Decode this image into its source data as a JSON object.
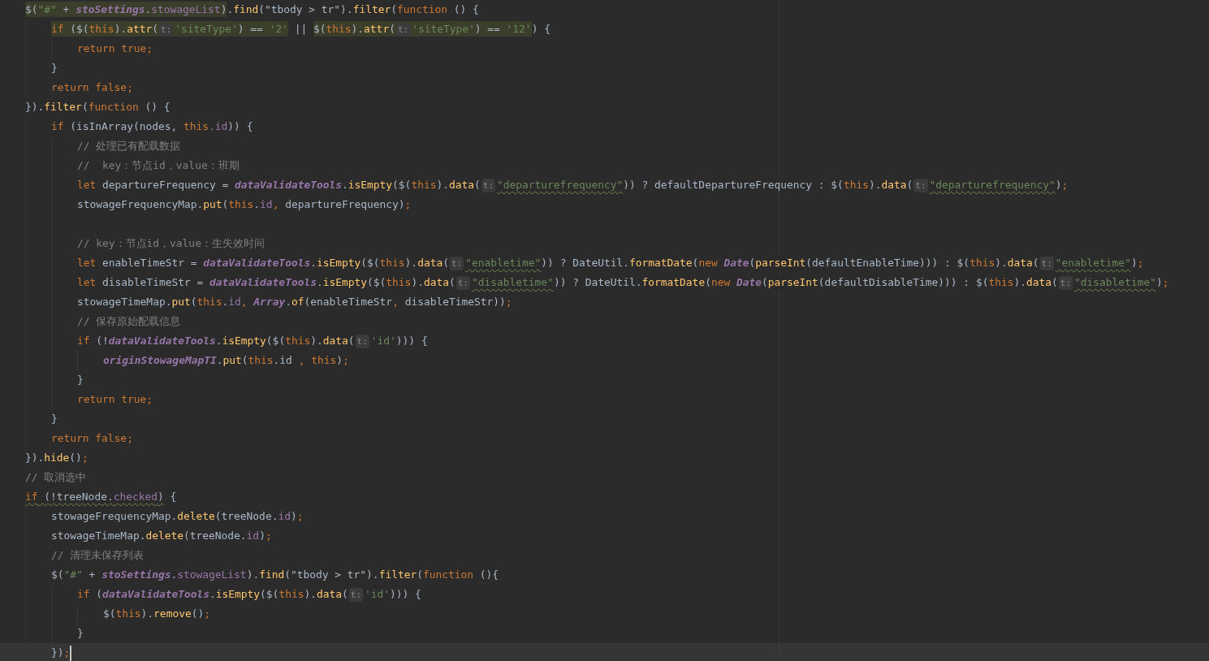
{
  "editor": {
    "lines": [
      {
        "current": false,
        "tokens": [
          {
            "kind": "highlight",
            "tokens": [
              {
                "kind": "plain",
                "text": "$("
              },
              {
                "kind": "string",
                "text": "\"#\""
              },
              {
                "kind": "plain",
                "text": " + "
              },
              {
                "kind": "static",
                "text": "stoSettings"
              },
              {
                "kind": "plain",
                "text": "."
              },
              {
                "kind": "field",
                "text": "stowageList"
              },
              {
                "kind": "plain",
                "text": ")"
              }
            ]
          },
          {
            "kind": "plain",
            "text": "."
          },
          {
            "kind": "method",
            "text": "find"
          },
          {
            "kind": "plain",
            "text": "(\"tbody > tr\")."
          },
          {
            "kind": "method",
            "text": "filter"
          },
          {
            "kind": "plain",
            "text": "("
          },
          {
            "kind": "keyword",
            "text": "function"
          },
          {
            "kind": "plain",
            "text": " () {"
          }
        ],
        "children": [
          {
            "current": false,
            "tokens": [
              {
                "kind": "highlight",
                "tokens": [
                  {
                    "kind": "keyword",
                    "text": "if"
                  },
                  {
                    "kind": "plain",
                    "text": " ($("
                  },
                  {
                    "kind": "keyword",
                    "text": "this"
                  },
                  {
                    "kind": "plain",
                    "text": ")."
                  },
                  {
                    "kind": "method",
                    "text": "attr"
                  },
                  {
                    "kind": "plain",
                    "text": "("
                  },
                  {
                    "kind": "hint",
                    "text": "t:"
                  },
                  {
                    "kind": "string",
                    "text": "'siteType'"
                  },
                  {
                    "kind": "plain",
                    "text": ") == "
                  },
                  {
                    "kind": "string",
                    "text": "'2'"
                  }
                ]
              },
              {
                "kind": "plain",
                "text": " || "
              },
              {
                "kind": "highlight",
                "tokens": [
                  {
                    "kind": "plain",
                    "text": "$("
                  },
                  {
                    "kind": "keyword",
                    "text": "this"
                  },
                  {
                    "kind": "plain",
                    "text": ")."
                  },
                  {
                    "kind": "method",
                    "text": "attr"
                  },
                  {
                    "kind": "plain",
                    "text": "("
                  },
                  {
                    "kind": "hint",
                    "text": "t:"
                  },
                  {
                    "kind": "string",
                    "text": "'siteType'"
                  },
                  {
                    "kind": "plain",
                    "text": ") == "
                  },
                  {
                    "kind": "string",
                    "text": "'12'"
                  }
                ]
              },
              {
                "kind": "plain",
                "text": ") {"
              }
            ],
            "children": [
              {
                "current": false,
                "tokens": [
                  {
                    "kind": "keyword",
                    "text": "return true;"
                  }
                ]
              }
            ]
          },
          {
            "current": false,
            "tokens": [
              {
                "kind": "plain",
                "text": "}"
              }
            ]
          },
          {
            "current": false,
            "tokens": [
              {
                "kind": "keyword",
                "text": "return false;"
              }
            ]
          }
        ]
      },
      {
        "current": false,
        "tokens": [
          {
            "kind": "plain",
            "text": "})."
          },
          {
            "kind": "method",
            "text": "filter"
          },
          {
            "kind": "plain",
            "text": "("
          },
          {
            "kind": "keyword",
            "text": "function"
          },
          {
            "kind": "plain",
            "text": " () {"
          }
        ],
        "children": [
          {
            "current": false,
            "tokens": [
              {
                "kind": "keyword",
                "text": "if"
              },
              {
                "kind": "plain",
                "text": " (isInArray(nodes, "
              },
              {
                "kind": "keyword",
                "text": "this"
              },
              {
                "kind": "field",
                "text": ".id"
              },
              {
                "kind": "plain",
                "text": ")) {"
              }
            ],
            "children": [
              {
                "current": false,
                "tokens": [
                  {
                    "kind": "comment",
                    "text": "// 处理已有配载数据"
                  }
                ]
              },
              {
                "current": false,
                "tokens": [
                  {
                    "kind": "comment",
                    "text": "//  key：节点id，value：班期"
                  }
                ]
              },
              {
                "current": false,
                "tokens": [
                  {
                    "kind": "keyword",
                    "text": "let"
                  },
                  {
                    "kind": "plain",
                    "text": " departureFrequency = "
                  },
                  {
                    "kind": "static",
                    "text": "dataValidateTools"
                  },
                  {
                    "kind": "plain",
                    "text": "."
                  },
                  {
                    "kind": "method",
                    "text": "isEmpty"
                  },
                  {
                    "kind": "plain",
                    "text": "($("
                  },
                  {
                    "kind": "keyword",
                    "text": "this"
                  },
                  {
                    "kind": "plain",
                    "text": ")."
                  },
                  {
                    "kind": "method",
                    "text": "data"
                  },
                  {
                    "kind": "plain",
                    "text": "("
                  },
                  {
                    "kind": "hint",
                    "text": "t:"
                  },
                  {
                    "kind": "warning",
                    "tokens": [
                      {
                        "kind": "string",
                        "text": "\"departurefrequency\""
                      }
                    ]
                  },
                  {
                    "kind": "plain",
                    "text": ")) ? defaultDepartureFrequency : $("
                  },
                  {
                    "kind": "keyword",
                    "text": "this"
                  },
                  {
                    "kind": "plain",
                    "text": ")."
                  },
                  {
                    "kind": "method",
                    "text": "data"
                  },
                  {
                    "kind": "plain",
                    "text": "("
                  },
                  {
                    "kind": "hint",
                    "text": "t:"
                  },
                  {
                    "kind": "warning",
                    "tokens": [
                      {
                        "kind": "string",
                        "text": "\"departurefrequency\""
                      }
                    ]
                  },
                  {
                    "kind": "plain",
                    "text": ")"
                  },
                  {
                    "kind": "keyword",
                    "text": ";"
                  }
                ]
              },
              {
                "current": false,
                "tokens": [
                  {
                    "kind": "plain",
                    "text": "stowageFrequencyMap."
                  },
                  {
                    "kind": "method",
                    "text": "put"
                  },
                  {
                    "kind": "plain",
                    "text": "("
                  },
                  {
                    "kind": "keyword",
                    "text": "this"
                  },
                  {
                    "kind": "plain",
                    "text": "."
                  },
                  {
                    "kind": "field",
                    "text": "id"
                  },
                  {
                    "kind": "keyword",
                    "text": ","
                  },
                  {
                    "kind": "plain",
                    "text": " departureFrequency)"
                  },
                  {
                    "kind": "keyword",
                    "text": ";"
                  }
                ]
              },
              {
                "current": false
              },
              {
                "current": false,
                "tokens": [
                  {
                    "kind": "comment",
                    "text": "// key：节点id，value：生失效时间"
                  }
                ]
              },
              {
                "current": false,
                "tokens": [
                  {
                    "kind": "keyword",
                    "text": "let"
                  },
                  {
                    "kind": "plain",
                    "text": " enableTimeStr = "
                  },
                  {
                    "kind": "static",
                    "text": "dataValidateTools"
                  },
                  {
                    "kind": "plain",
                    "text": "."
                  },
                  {
                    "kind": "method",
                    "text": "isEmpty"
                  },
                  {
                    "kind": "plain",
                    "text": "($("
                  },
                  {
                    "kind": "keyword",
                    "text": "this"
                  },
                  {
                    "kind": "plain",
                    "text": ")."
                  },
                  {
                    "kind": "method",
                    "text": "data"
                  },
                  {
                    "kind": "plain",
                    "text": "("
                  },
                  {
                    "kind": "hint",
                    "text": "t:"
                  },
                  {
                    "kind": "warning",
                    "tokens": [
                      {
                        "kind": "string",
                        "text": "\"enabletime\""
                      }
                    ]
                  },
                  {
                    "kind": "plain",
                    "text": ")) ? DateUtil."
                  },
                  {
                    "kind": "method",
                    "text": "formatDate"
                  },
                  {
                    "kind": "plain",
                    "text": "("
                  },
                  {
                    "kind": "keyword",
                    "text": "new "
                  },
                  {
                    "kind": "static",
                    "text": "Date"
                  },
                  {
                    "kind": "plain",
                    "text": "("
                  },
                  {
                    "kind": "method",
                    "text": "parseInt"
                  },
                  {
                    "kind": "plain",
                    "text": "(defaultEnableTime))) : $("
                  },
                  {
                    "kind": "keyword",
                    "text": "this"
                  },
                  {
                    "kind": "plain",
                    "text": ")."
                  },
                  {
                    "kind": "method",
                    "text": "data"
                  },
                  {
                    "kind": "plain",
                    "text": "("
                  },
                  {
                    "kind": "hint",
                    "text": "t:"
                  },
                  {
                    "kind": "warning",
                    "tokens": [
                      {
                        "kind": "string",
                        "text": "\"enabletime\""
                      }
                    ]
                  },
                  {
                    "kind": "plain",
                    "text": ")"
                  },
                  {
                    "kind": "keyword",
                    "text": ";"
                  }
                ]
              },
              {
                "current": false,
                "tokens": [
                  {
                    "kind": "keyword",
                    "text": "let"
                  },
                  {
                    "kind": "plain",
                    "text": " disableTimeStr = "
                  },
                  {
                    "kind": "static",
                    "text": "dataValidateTools"
                  },
                  {
                    "kind": "plain",
                    "text": "."
                  },
                  {
                    "kind": "method",
                    "text": "isEmpty"
                  },
                  {
                    "kind": "plain",
                    "text": "($("
                  },
                  {
                    "kind": "keyword",
                    "text": "this"
                  },
                  {
                    "kind": "plain",
                    "text": ")."
                  },
                  {
                    "kind": "method",
                    "text": "data"
                  },
                  {
                    "kind": "plain",
                    "text": "("
                  },
                  {
                    "kind": "hint",
                    "text": "t:"
                  },
                  {
                    "kind": "warning",
                    "tokens": [
                      {
                        "kind": "string",
                        "text": "\"disabletime\""
                      }
                    ]
                  },
                  {
                    "kind": "plain",
                    "text": ")) ? DateUtil."
                  },
                  {
                    "kind": "method",
                    "text": "formatDate"
                  },
                  {
                    "kind": "plain",
                    "text": "("
                  },
                  {
                    "kind": "keyword",
                    "text": "new "
                  },
                  {
                    "kind": "static",
                    "text": "Date"
                  },
                  {
                    "kind": "plain",
                    "text": "("
                  },
                  {
                    "kind": "method",
                    "text": "parseInt"
                  },
                  {
                    "kind": "plain",
                    "text": "(defaultDisableTime))) : $("
                  },
                  {
                    "kind": "keyword",
                    "text": "this"
                  },
                  {
                    "kind": "plain",
                    "text": ")."
                  },
                  {
                    "kind": "method",
                    "text": "data"
                  },
                  {
                    "kind": "plain",
                    "text": "("
                  },
                  {
                    "kind": "hint",
                    "text": "t:"
                  },
                  {
                    "kind": "warning",
                    "tokens": [
                      {
                        "kind": "string",
                        "text": "\"disabletime\""
                      }
                    ]
                  },
                  {
                    "kind": "plain",
                    "text": ")"
                  },
                  {
                    "kind": "keyword",
                    "text": ";"
                  }
                ]
              },
              {
                "current": false,
                "tokens": [
                  {
                    "kind": "plain",
                    "text": "stowageTimeMap."
                  },
                  {
                    "kind": "method",
                    "text": "put"
                  },
                  {
                    "kind": "plain",
                    "text": "("
                  },
                  {
                    "kind": "keyword",
                    "text": "this"
                  },
                  {
                    "kind": "plain",
                    "text": "."
                  },
                  {
                    "kind": "field",
                    "text": "id"
                  },
                  {
                    "kind": "keyword",
                    "text": ", "
                  },
                  {
                    "kind": "static",
                    "text": "Array"
                  },
                  {
                    "kind": "plain",
                    "text": "."
                  },
                  {
                    "kind": "method",
                    "text": "of"
                  },
                  {
                    "kind": "plain",
                    "text": "(enableTimeStr"
                  },
                  {
                    "kind": "keyword",
                    "text": ","
                  },
                  {
                    "kind": "plain",
                    "text": " disableTimeStr))"
                  },
                  {
                    "kind": "keyword",
                    "text": ";"
                  }
                ]
              },
              {
                "current": false,
                "tokens": [
                  {
                    "kind": "comment",
                    "text": "// 保存原始配载信息"
                  }
                ]
              },
              {
                "current": false,
                "tokens": [
                  {
                    "kind": "keyword",
                    "text": "if"
                  },
                  {
                    "kind": "plain",
                    "text": " (!"
                  },
                  {
                    "kind": "static",
                    "text": "dataValidateTools"
                  },
                  {
                    "kind": "plain",
                    "text": "."
                  },
                  {
                    "kind": "method",
                    "text": "isEmpty"
                  },
                  {
                    "kind": "plain",
                    "text": "($("
                  },
                  {
                    "kind": "keyword",
                    "text": "this"
                  },
                  {
                    "kind": "plain",
                    "text": ")."
                  },
                  {
                    "kind": "method",
                    "text": "data"
                  },
                  {
                    "kind": "plain",
                    "text": "("
                  },
                  {
                    "kind": "hint",
                    "text": "t:"
                  },
                  {
                    "kind": "string",
                    "text": "'id'"
                  },
                  {
                    "kind": "plain",
                    "text": "))) {"
                  }
                ],
                "children": [
                  {
                    "current": false,
                    "tokens": [
                      {
                        "kind": "static",
                        "text": "originStowageMapTI"
                      },
                      {
                        "kind": "plain",
                        "text": "."
                      },
                      {
                        "kind": "method",
                        "text": "put"
                      },
                      {
                        "kind": "plain",
                        "text": "("
                      },
                      {
                        "kind": "keyword",
                        "text": "this"
                      },
                      {
                        "kind": "plain",
                        "text": ".id "
                      },
                      {
                        "kind": "keyword",
                        "text": ", "
                      },
                      {
                        "kind": "keyword",
                        "text": "this"
                      },
                      {
                        "kind": "plain",
                        "text": ")"
                      },
                      {
                        "kind": "keyword",
                        "text": ";"
                      }
                    ]
                  }
                ]
              },
              {
                "current": false,
                "tokens": [
                  {
                    "kind": "plain",
                    "text": "}"
                  }
                ]
              },
              {
                "current": false,
                "tokens": [
                  {
                    "kind": "keyword",
                    "text": "return true;"
                  }
                ]
              }
            ]
          },
          {
            "current": false,
            "tokens": [
              {
                "kind": "plain",
                "text": "}"
              }
            ]
          },
          {
            "current": false,
            "tokens": [
              {
                "kind": "keyword",
                "text": "return false;"
              }
            ]
          }
        ]
      },
      {
        "current": false,
        "tokens": [
          {
            "kind": "plain",
            "text": "})."
          },
          {
            "kind": "method",
            "text": "hide"
          },
          {
            "kind": "plain",
            "text": "()"
          },
          {
            "kind": "keyword",
            "text": ";"
          }
        ]
      },
      {
        "current": false,
        "tokens": [
          {
            "kind": "comment",
            "text": "// 取消选中"
          }
        ]
      },
      {
        "current": false,
        "tokens": [
          {
            "kind": "warning",
            "tokens": [
              {
                "kind": "keyword",
                "text": "if"
              },
              {
                "kind": "plain",
                "text": " (!treeNode."
              },
              {
                "kind": "field",
                "text": "checked"
              },
              {
                "kind": "plain",
                "text": ")"
              }
            ]
          },
          {
            "kind": "plain",
            "text": " {"
          }
        ],
        "children": [
          {
            "current": false,
            "tokens": [
              {
                "kind": "plain",
                "text": "stowageFrequencyMap."
              },
              {
                "kind": "method",
                "text": "delete"
              },
              {
                "kind": "plain",
                "text": "(treeNode."
              },
              {
                "kind": "field",
                "text": "id"
              },
              {
                "kind": "plain",
                "text": ")"
              },
              {
                "kind": "keyword",
                "text": ";"
              }
            ]
          },
          {
            "current": false,
            "tokens": [
              {
                "kind": "plain",
                "text": "stowageTimeMap."
              },
              {
                "kind": "method",
                "text": "delete"
              },
              {
                "kind": "plain",
                "text": "(treeNode."
              },
              {
                "kind": "field",
                "text": "id"
              },
              {
                "kind": "plain",
                "text": ")"
              },
              {
                "kind": "keyword",
                "text": ";"
              }
            ]
          },
          {
            "current": false,
            "tokens": [
              {
                "kind": "comment",
                "text": "// 清理未保存列表"
              }
            ]
          },
          {
            "current": false,
            "tokens": [
              {
                "kind": "plain",
                "text": "$("
              },
              {
                "kind": "string",
                "text": "\"#\""
              },
              {
                "kind": "plain",
                "text": " + "
              },
              {
                "kind": "static",
                "text": "stoSettings"
              },
              {
                "kind": "plain",
                "text": "."
              },
              {
                "kind": "field",
                "text": "stowageList"
              },
              {
                "kind": "plain",
                "text": ")."
              },
              {
                "kind": "method",
                "text": "find"
              },
              {
                "kind": "plain",
                "text": "(\"tbody > tr\")."
              },
              {
                "kind": "method",
                "text": "filter"
              },
              {
                "kind": "plain",
                "text": "("
              },
              {
                "kind": "keyword",
                "text": "function"
              },
              {
                "kind": "plain",
                "text": " (){"
              }
            ],
            "children": [
              {
                "current": false,
                "tokens": [
                  {
                    "kind": "keyword",
                    "text": "if"
                  },
                  {
                    "kind": "plain",
                    "text": " ("
                  },
                  {
                    "kind": "static",
                    "text": "dataValidateTools"
                  },
                  {
                    "kind": "plain",
                    "text": "."
                  },
                  {
                    "kind": "method",
                    "text": "isEmpty"
                  },
                  {
                    "kind": "plain",
                    "text": "($("
                  },
                  {
                    "kind": "keyword",
                    "text": "this"
                  },
                  {
                    "kind": "plain",
                    "text": ")."
                  },
                  {
                    "kind": "method",
                    "text": "data"
                  },
                  {
                    "kind": "plain",
                    "text": "("
                  },
                  {
                    "kind": "hint",
                    "text": "t:"
                  },
                  {
                    "kind": "string",
                    "text": "'id'"
                  },
                  {
                    "kind": "plain",
                    "text": "))) {"
                  }
                ],
                "children": [
                  {
                    "current": false,
                    "tokens": [
                      {
                        "kind": "plain",
                        "text": "$("
                      },
                      {
                        "kind": "keyword",
                        "text": "this"
                      },
                      {
                        "kind": "plain",
                        "text": ")."
                      },
                      {
                        "kind": "method",
                        "text": "remove"
                      },
                      {
                        "kind": "plain",
                        "text": "()"
                      },
                      {
                        "kind": "keyword",
                        "text": ";"
                      }
                    ]
                  }
                ]
              },
              {
                "current": false,
                "tokens": [
                  {
                    "kind": "plain",
                    "text": "}"
                  }
                ]
              }
            ]
          },
          {
            "current": true,
            "tokens": [
              {
                "kind": "plain",
                "text": "})"
              },
              {
                "kind": "keyword",
                "text": ";"
              }
            ]
          }
        ]
      }
    ]
  }
}
